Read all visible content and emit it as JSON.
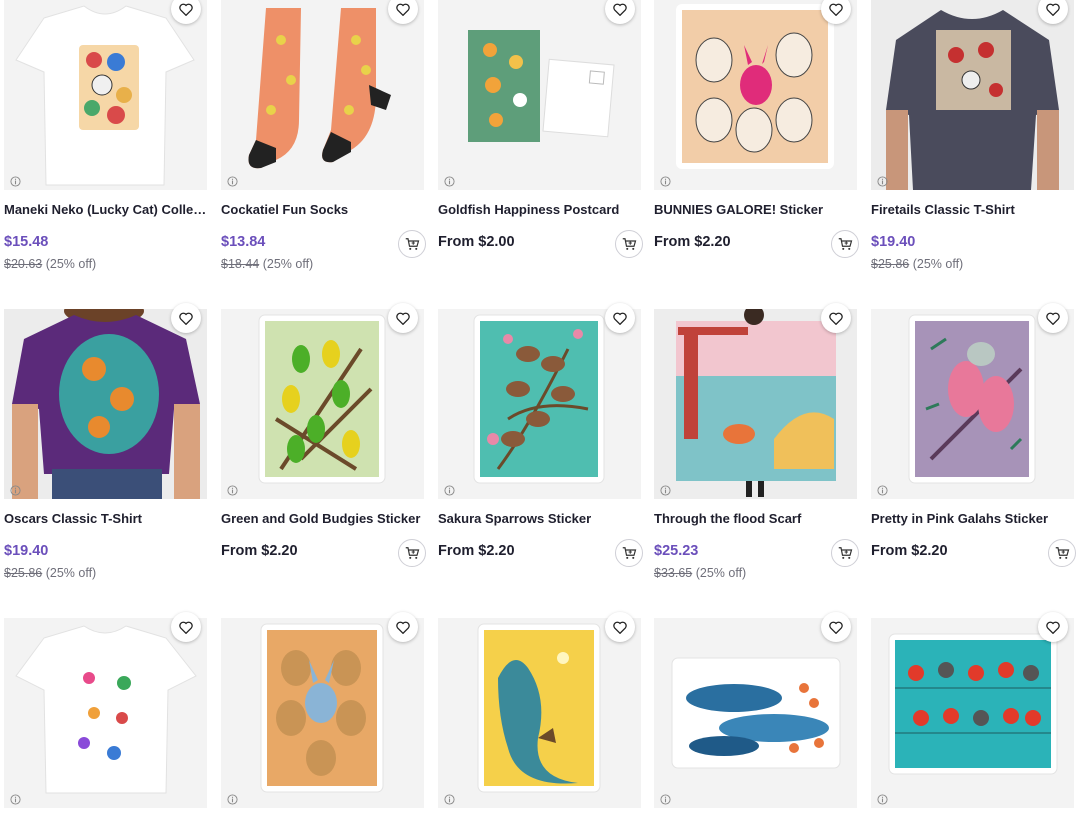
{
  "products": [
    {
      "title": "Maneki Neko (Lucky Cat) Collect...",
      "price": "$15.48",
      "original_price": "$20.63",
      "discount": "(25% off)",
      "sale": true,
      "has_cart": false,
      "icon": "tshirt-image"
    },
    {
      "title": "Cockatiel Fun Socks",
      "price": "$13.84",
      "original_price": "$18.44",
      "discount": "(25% off)",
      "sale": true,
      "has_cart": true,
      "icon": "socks-image"
    },
    {
      "title": "Goldfish Happiness Postcard",
      "price": "From $2.00",
      "sale": false,
      "has_cart": true,
      "icon": "postcard-image"
    },
    {
      "title": "BUNNIES GALORE! Sticker",
      "price": "From $2.20",
      "sale": false,
      "has_cart": true,
      "icon": "sticker-image"
    },
    {
      "title": "Firetails Classic T-Shirt",
      "price": "$19.40",
      "original_price": "$25.86",
      "discount": "(25% off)",
      "sale": true,
      "has_cart": false,
      "icon": "tshirt-image"
    },
    {
      "title": "Oscars Classic T-Shirt",
      "price": "$19.40",
      "original_price": "$25.86",
      "discount": "(25% off)",
      "sale": true,
      "has_cart": false,
      "icon": "tshirt-image"
    },
    {
      "title": "Green and Gold Budgies Sticker",
      "price": "From $2.20",
      "sale": false,
      "has_cart": true,
      "icon": "sticker-image"
    },
    {
      "title": "Sakura Sparrows Sticker",
      "price": "From $2.20",
      "sale": false,
      "has_cart": true,
      "icon": "sticker-image"
    },
    {
      "title": "Through the flood Scarf",
      "price": "$25.23",
      "original_price": "$33.65",
      "discount": "(25% off)",
      "sale": true,
      "has_cart": true,
      "icon": "scarf-image"
    },
    {
      "title": "Pretty in Pink Galahs Sticker",
      "price": "From $2.20",
      "sale": false,
      "has_cart": true,
      "icon": "sticker-image"
    },
    {
      "title": "",
      "price": "",
      "sale": false,
      "has_cart": false,
      "icon": "tshirt-image"
    },
    {
      "title": "",
      "price": "",
      "sale": false,
      "has_cart": false,
      "icon": "sticker-image"
    },
    {
      "title": "",
      "price": "",
      "sale": false,
      "has_cart": false,
      "icon": "sticker-image"
    },
    {
      "title": "",
      "price": "",
      "sale": false,
      "has_cart": false,
      "icon": "sticker-image"
    },
    {
      "title": "",
      "price": "",
      "sale": false,
      "has_cart": false,
      "icon": "sticker-image"
    }
  ],
  "colors": {
    "sale_price": "#6b4fbb",
    "text": "#1f1f2e",
    "muted": "#6f6f7a",
    "image_bg": "#f2f2f2"
  }
}
